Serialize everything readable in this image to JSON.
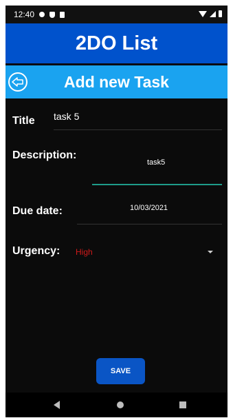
{
  "status_bar": {
    "time": "12:40"
  },
  "app_bar": {
    "title": "2DO List"
  },
  "sub_bar": {
    "title": "Add new Task"
  },
  "form": {
    "title_label": "Title",
    "title_value": "task 5",
    "description_label": "Description:",
    "description_value": "task5",
    "due_date_label": "Due date:",
    "due_date_value": "10/03/2021",
    "urgency_label": "Urgency:",
    "urgency_value": "High"
  },
  "actions": {
    "save_label": "SAVE"
  },
  "colors": {
    "app_bar": "#0052cc",
    "sub_bar": "#1aa3f0",
    "background": "#0b0b0b",
    "urgency_high": "#d11a1a",
    "focus_underline": "#1e9c8a",
    "save_button": "#0a55c5"
  },
  "icons": {
    "back": "arrow-left-circle-icon",
    "status": [
      "gear-icon",
      "shield-icon",
      "sim-card-icon",
      "wifi-icon",
      "signal-icon",
      "battery-icon"
    ],
    "navigation": [
      "nav-back-icon",
      "nav-home-icon",
      "nav-recent-icon"
    ]
  }
}
